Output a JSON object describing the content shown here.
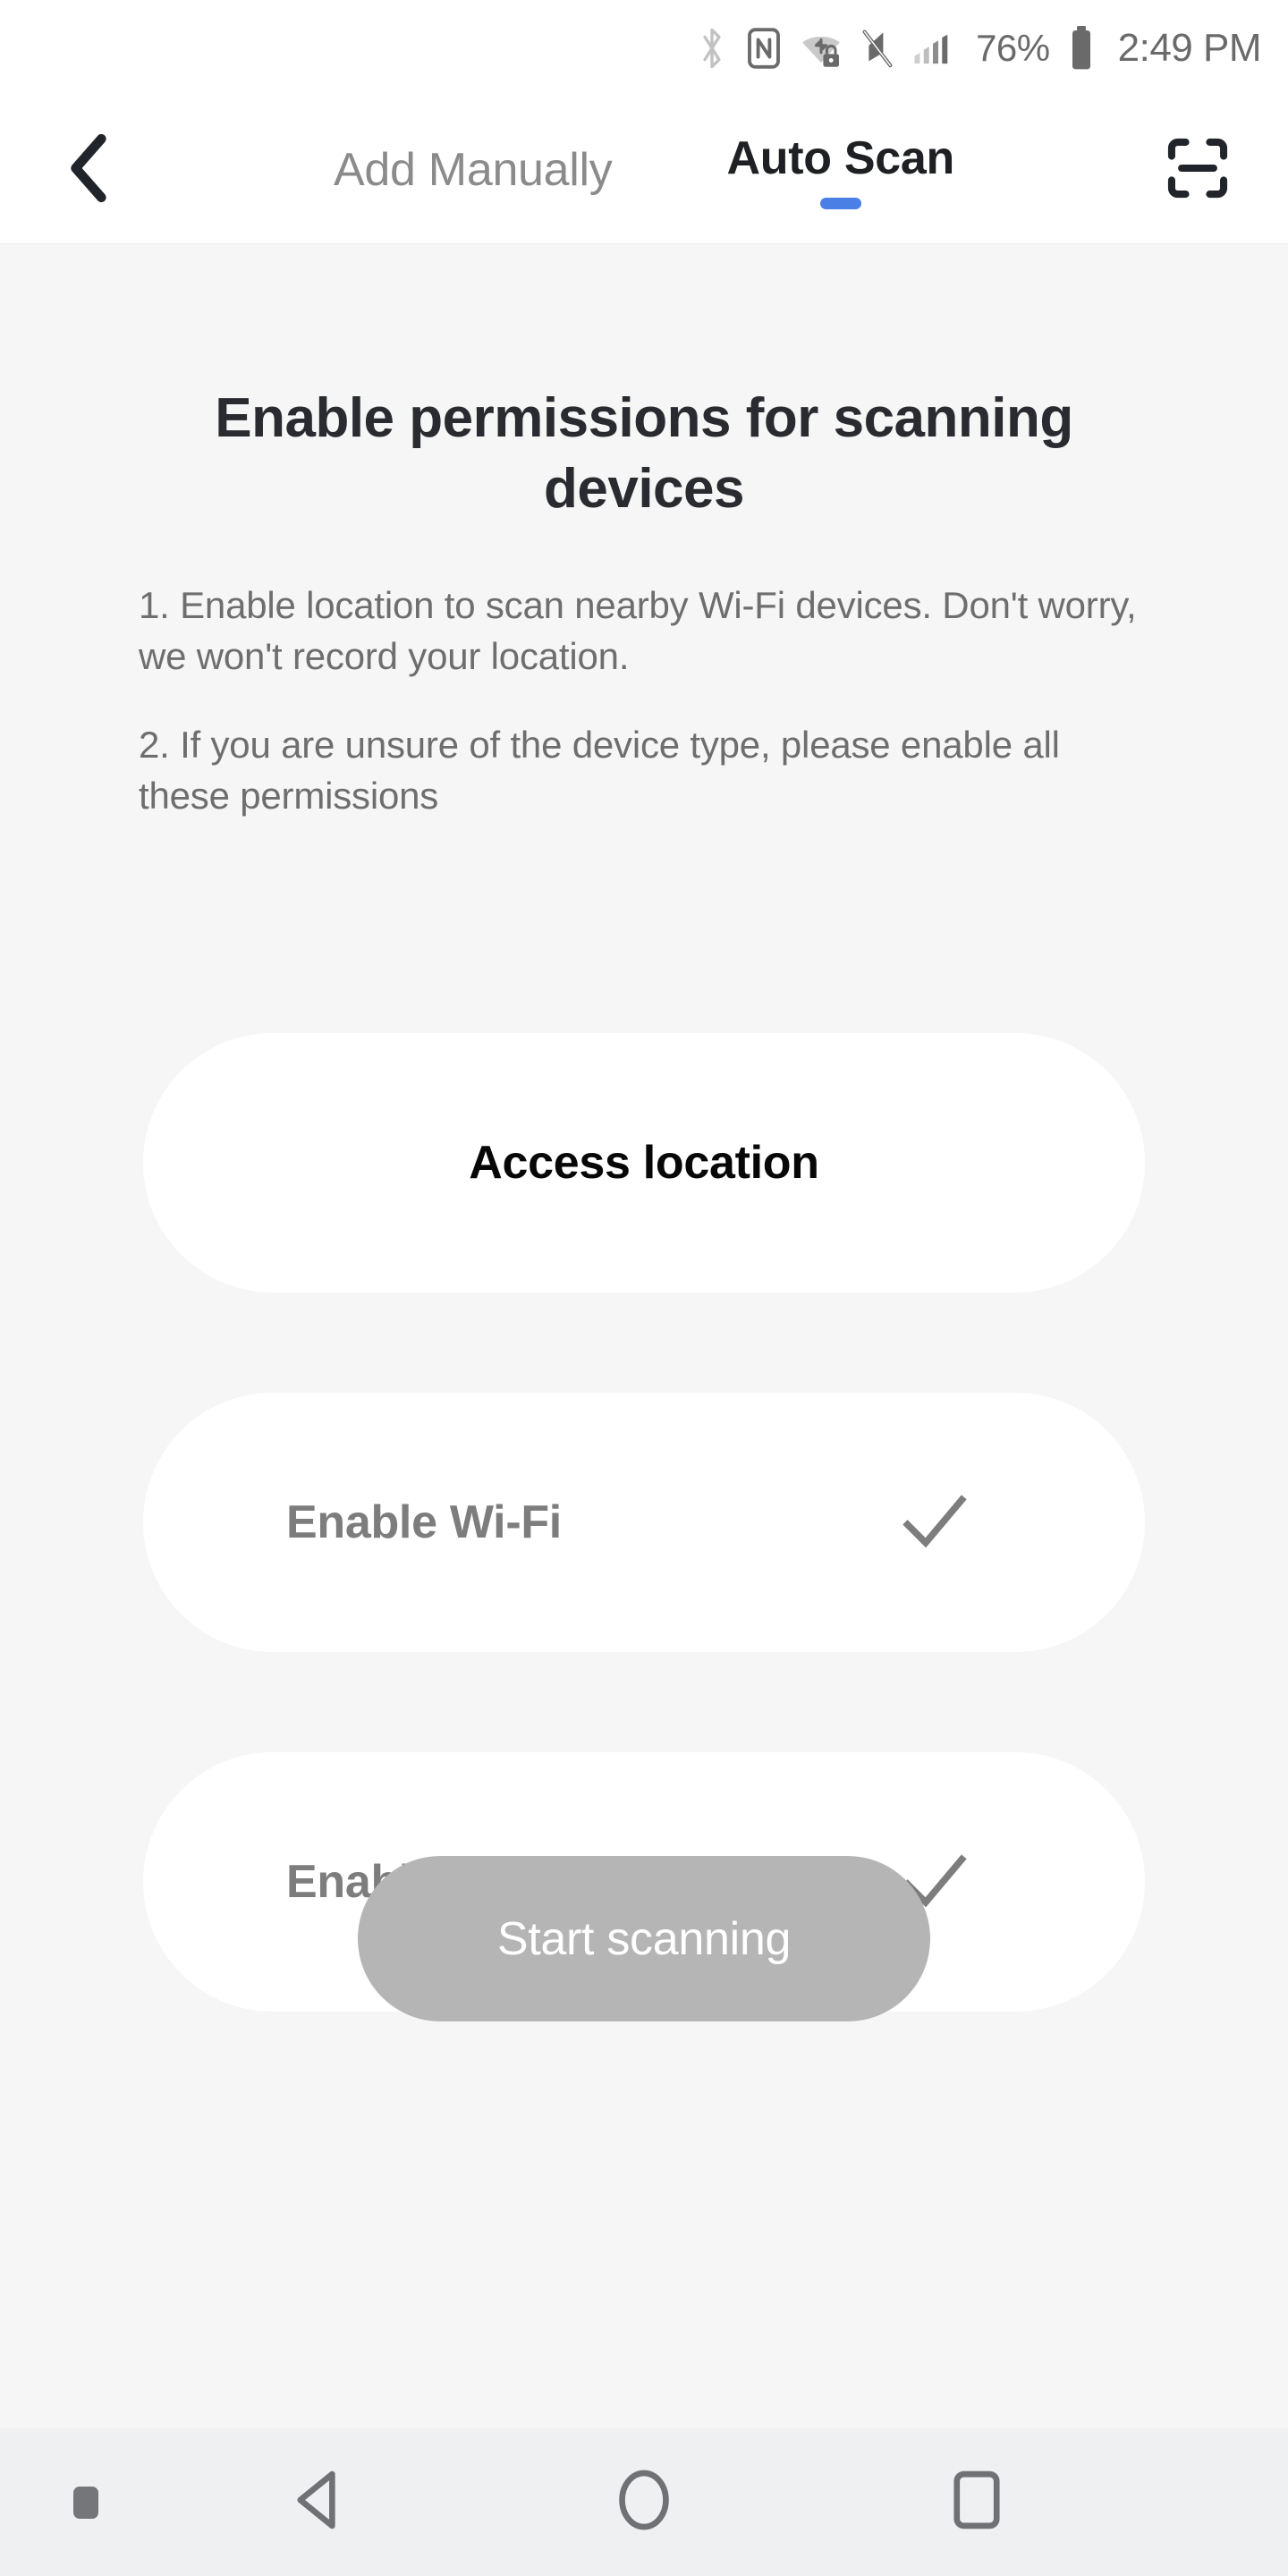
{
  "status_bar": {
    "icons": [
      {
        "name": "bluetooth-icon",
        "state": "inactive"
      },
      {
        "name": "nfc-icon",
        "state": "active"
      },
      {
        "name": "wifi-vpn-lock-icon",
        "state": "active"
      },
      {
        "name": "mute-icon",
        "state": "active"
      },
      {
        "name": "cellular-signal-icon",
        "state": "active"
      }
    ],
    "battery_percent": "76%",
    "time": "2:49 PM"
  },
  "header": {
    "back_icon": "chevron-left-icon",
    "scan_icon": "qr-scan-icon",
    "tabs": [
      {
        "label": "Add Manually",
        "active": false
      },
      {
        "label": "Auto Scan",
        "active": true
      }
    ],
    "active_tab_indicator_color": "#4a80e6"
  },
  "main": {
    "title": "Enable permissions for scanning devices",
    "instructions": [
      "1. Enable location to scan nearby Wi-Fi devices. Don't worry, we won't record your location.",
      "2. If you are unsure of the device type, please enable all these permissions"
    ],
    "permissions": [
      {
        "label": "Access location",
        "granted": false,
        "align": "center",
        "label_color": "#070707"
      },
      {
        "label": "Enable Wi-Fi",
        "granted": true,
        "align": "left",
        "label_color": "#7d7d7d",
        "check_icon": "check-icon"
      },
      {
        "label": "Enable Bluetooth",
        "granted": true,
        "align": "left",
        "label_color": "#7d7d7d",
        "check_icon": "check-icon"
      }
    ],
    "primary_button": {
      "label": "Start scanning",
      "enabled": false,
      "background": "#b5b5b5",
      "text_color": "#ffffff"
    }
  },
  "nav_bar": {
    "indicator_icon": "keyboard-hide-indicator-icon",
    "buttons": [
      {
        "name": "nav-back-icon",
        "label": "Back"
      },
      {
        "name": "nav-home-icon",
        "label": "Home"
      },
      {
        "name": "nav-recents-icon",
        "label": "Recents"
      }
    ]
  }
}
